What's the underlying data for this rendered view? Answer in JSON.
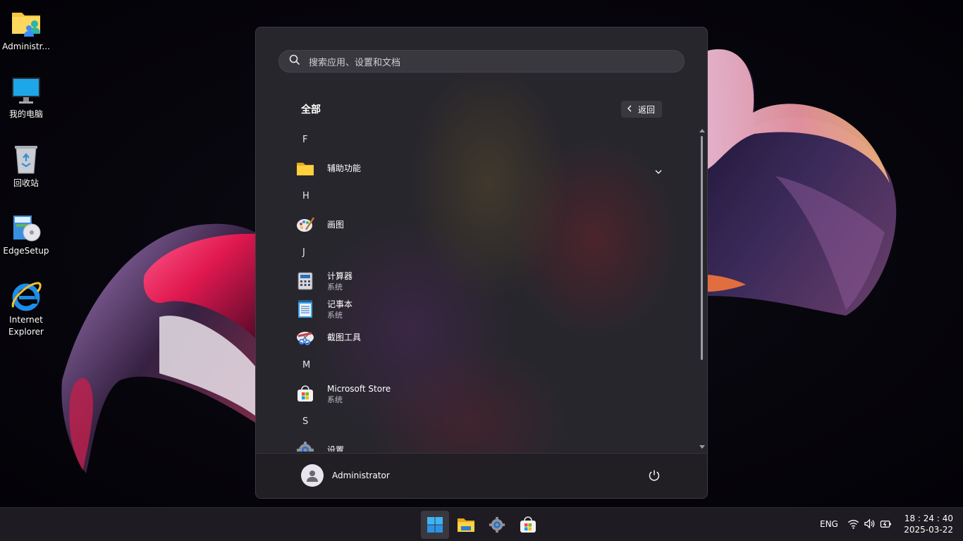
{
  "desktop": {
    "icons": [
      {
        "label": "Administr...",
        "icon": "user-folder-icon"
      },
      {
        "label": "我的电脑",
        "icon": "computer-monitor-icon"
      },
      {
        "label": "回收站",
        "icon": "recycle-bin-icon"
      },
      {
        "label": "EdgeSetup",
        "icon": "installer-icon"
      },
      {
        "label": "Internet Explorer",
        "icon": "internet-explorer-icon"
      }
    ]
  },
  "start_menu": {
    "search_placeholder": "搜索应用、设置和文档",
    "section_title": "全部",
    "back_label": "返回",
    "groups": [
      {
        "letter": "F",
        "apps": [
          {
            "name": "辅助功能",
            "subtitle": "",
            "icon": "folder-icon",
            "expandable": true
          }
        ]
      },
      {
        "letter": "H",
        "apps": [
          {
            "name": "画图",
            "subtitle": "",
            "icon": "paint-palette-icon"
          }
        ]
      },
      {
        "letter": "J",
        "apps": [
          {
            "name": "计算器",
            "subtitle": "系统",
            "icon": "calculator-icon"
          },
          {
            "name": "记事本",
            "subtitle": "系统",
            "icon": "notepad-icon"
          },
          {
            "name": "截图工具",
            "subtitle": "",
            "icon": "snipping-tool-icon"
          }
        ]
      },
      {
        "letter": "M",
        "apps": [
          {
            "name": "Microsoft Store",
            "subtitle": "系统",
            "icon": "store-icon"
          }
        ]
      },
      {
        "letter": "S",
        "apps": [
          {
            "name": "设置",
            "subtitle": "",
            "icon": "settings-gear-icon"
          }
        ]
      }
    ],
    "user": {
      "name": "Administrator"
    },
    "power_icon": "power-icon"
  },
  "taskbar": {
    "apps": [
      {
        "name": "Start",
        "icon": "windows-start-icon",
        "active": true
      },
      {
        "name": "File Explorer",
        "icon": "file-explorer-icon",
        "active": false
      },
      {
        "name": "Settings",
        "icon": "settings-gear-icon",
        "active": false
      },
      {
        "name": "Microsoft Store",
        "icon": "store-icon",
        "active": false
      }
    ],
    "language": "ENG",
    "tray_icons": [
      "wifi-icon",
      "volume-icon",
      "battery-icon"
    ],
    "time": "18 : 24 : 40",
    "date": "2025-03-22"
  },
  "colors": {
    "start_bg": "#28262d",
    "taskbar_bg": "#1e1c22",
    "accent_blue": "#3d8bfd"
  }
}
